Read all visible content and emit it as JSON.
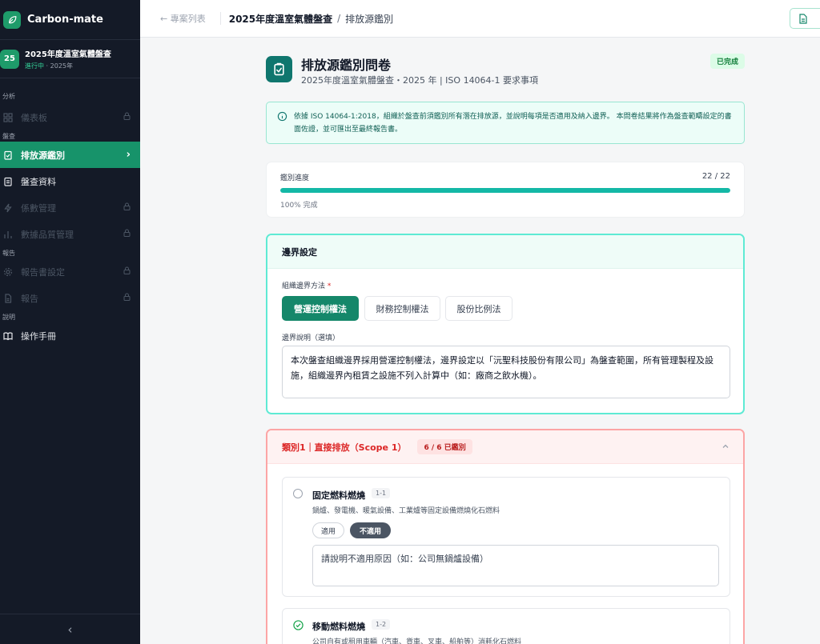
{
  "brand": {
    "name": "Carbon-mate"
  },
  "project": {
    "badge": "25",
    "name": "2025年度溫室氣體盤查",
    "status": "進行中",
    "sub": "· 2025年"
  },
  "sidebar": {
    "sections": [
      {
        "label": "分析"
      },
      {
        "label": "盤查"
      },
      {
        "label": "報告"
      },
      {
        "label": "說明"
      }
    ],
    "items": [
      {
        "label": "儀表板"
      },
      {
        "label": "排放源鑑別"
      },
      {
        "label": "盤查資料"
      },
      {
        "label": "係數管理"
      },
      {
        "label": "數據品質管理"
      },
      {
        "label": "報告書設定"
      },
      {
        "label": "報告"
      },
      {
        "label": "操作手冊"
      }
    ],
    "lock_glyph": "🔒",
    "chevron_right": "›",
    "collapse_glyph": "‹"
  },
  "topbar": {
    "back_label": "← 專案列表",
    "crumb_project": "2025年度溫室氣體盤查",
    "crumb_sep": "/",
    "crumb_current": "排放源鑑別"
  },
  "page": {
    "title": "排放源鑑別問卷",
    "subtitle": "2025年度溫室氣體盤查・2025 年 | ISO 14064-1 要求事項",
    "status_badge": "已完成"
  },
  "info": {
    "text": "依據 ISO 14064-1:2018，組織於盤查前須鑑別所有潛在排放源，並說明每項是否適用及納入邊界。 本問卷結果將作為盤查範疇設定的書面佐證，並可匯出至最終報告書。"
  },
  "progress": {
    "label": "鑑別進度",
    "count_text": "22  /  22",
    "done": 22,
    "total": 22,
    "percent_text": "100% 完成"
  },
  "boundary": {
    "title": "邊界設定",
    "method_label": "組織邊界方法",
    "required_mark": "*",
    "methods": [
      {
        "label": "營運控制權法"
      },
      {
        "label": "財務控制權法"
      },
      {
        "label": "股份比例法"
      }
    ],
    "desc_label": "邊界說明（選填）",
    "desc_value": "本次盤查組織邊界採用營運控制權法，邊界設定以「沅聖科技股份有限公司」為盤查範圍，所有管理製程及設施，組織邊界內租賃之設施不列入計算中（如：廠商之飲水機）。"
  },
  "category": {
    "title": "類別1｜直接排放（Scope 1）",
    "badge": "6 / 6 已鑑別",
    "items": [
      {
        "title": "固定燃料燃燒",
        "code": "1-1",
        "desc": "鍋爐、發電機、暖氣設備、工業爐等固定設備燃燒化石燃料",
        "yes_label": "適用",
        "no_label": "不適用",
        "reason_placeholder": "請說明不適用原因（如：公司無鍋爐設備）"
      },
      {
        "title": "移動燃料燃燒",
        "code": "1-2",
        "desc": "公司自有或租用車輛（汽車、貨車、叉車、船舶等）消耗化石燃料"
      }
    ]
  },
  "colors": {
    "primary": "#17936a",
    "sidebar_bg": "#141a27",
    "alert": "#dc2626"
  }
}
